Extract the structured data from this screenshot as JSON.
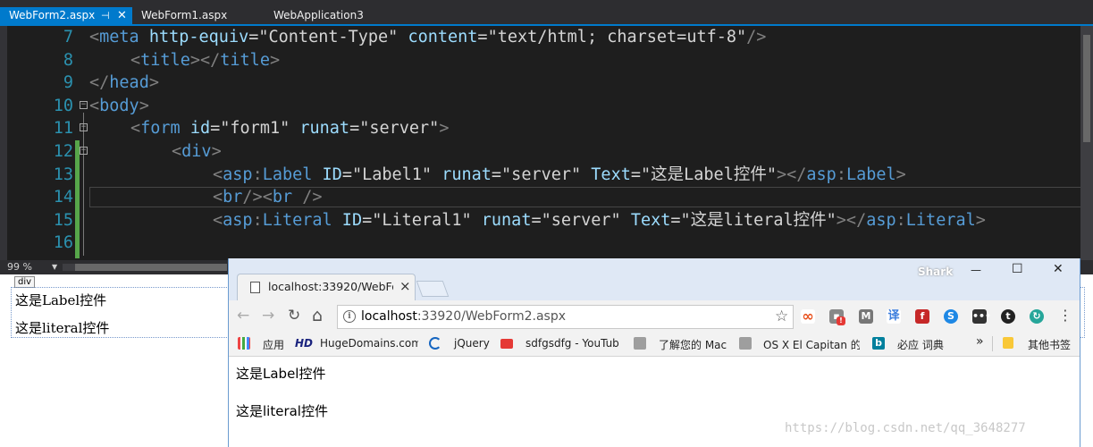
{
  "ide": {
    "tabs": [
      {
        "label": "WebForm2.aspx",
        "active": true
      },
      {
        "label": "WebForm1.aspx",
        "active": false
      },
      {
        "label": "WebApplication3",
        "active": false
      }
    ],
    "pin_icon": "pin-icon",
    "close_icon": "close-icon",
    "code_lines": [
      {
        "n": "7"
      },
      {
        "n": "8"
      },
      {
        "n": "9"
      },
      {
        "n": "10"
      },
      {
        "n": "11"
      },
      {
        "n": "12"
      },
      {
        "n": "13"
      },
      {
        "n": "14"
      },
      {
        "n": "15"
      },
      {
        "n": "16"
      }
    ],
    "code": {
      "l7_a": "<",
      "l7_tag": "meta",
      "l7_attr1": " http-equiv",
      "l7_eq1": "=",
      "l7_val1": "\"Content-Type\"",
      "l7_attr2": " content",
      "l7_eq2": "=",
      "l7_val2": "\"text/html; charset=utf-8\"",
      "l7_end": "/>",
      "l8_a": "<",
      "l8_tag": "title",
      "l8_b": "></",
      "l8_tag2": "title",
      "l8_c": ">",
      "l9_a": "</",
      "l9_tag": "head",
      "l9_b": ">",
      "l10_a": "<",
      "l10_tag": "body",
      "l10_b": ">",
      "l11_a": "<",
      "l11_tag": "form",
      "l11_attr1": " id",
      "l11_eq1": "=",
      "l11_val1": "\"form1\"",
      "l11_attr2": " runat",
      "l11_eq2": "=",
      "l11_val2": "\"server\"",
      "l11_b": ">",
      "l12_a": "<",
      "l12_tag": "div",
      "l12_b": ">",
      "l13_a": "<",
      "l13_tag": "asp",
      "l13_colon": ":",
      "l13_tag2": "Label",
      "l13_attr1": " ID",
      "l13_eq1": "=",
      "l13_val1": "\"Label1\"",
      "l13_attr2": " runat",
      "l13_eq2": "=",
      "l13_val2": "\"server\"",
      "l13_attr3": " Text",
      "l13_eq3": "=",
      "l13_val3": "\"这是Label控件\"",
      "l13_b": "></",
      "l13_tag3": "asp",
      "l13_colon2": ":",
      "l13_tag4": "Label",
      "l13_c": ">",
      "l14_a": "<",
      "l14_tag": "br",
      "l14_b": "/><",
      "l14_tag2": "br",
      "l14_c": " />",
      "l15_a": "<",
      "l15_tag": "asp",
      "l15_colon": ":",
      "l15_tag2": "Literal",
      "l15_attr1": " ID",
      "l15_eq1": "=",
      "l15_val1": "\"Literal1\"",
      "l15_attr2": " runat",
      "l15_eq2": "=",
      "l15_val2": "\"server\"",
      "l15_attr3": " Text",
      "l15_eq3": "=",
      "l15_val3": "\"这是literal控件\"",
      "l15_b": "></",
      "l15_tag3": "asp",
      "l15_colon2": ":",
      "l15_tag4": "Literal",
      "l15_c": ">"
    },
    "fold_collapse_glyph": "−",
    "zoom": "99 %",
    "zoom_arrow": "▼",
    "design": {
      "div_tag": "div",
      "label_text": "这是Label控件",
      "literal_text": "这是literal控件"
    }
  },
  "browser": {
    "tab_title": "localhost:33920/WebFo",
    "tab_close": "×",
    "profile": "Shark",
    "win_min": "—",
    "win_max": "☐",
    "win_close": "✕",
    "nav": {
      "back": "←",
      "forward": "→",
      "reload": "↻",
      "home": "⌂"
    },
    "url_host": "localhost",
    "url_rest": ":33920/WebForm2.aspx",
    "lock_glyph": "i",
    "star": "☆",
    "menu": "⋮",
    "bookmarks": [
      {
        "label": "应用",
        "icon": "apps-icon"
      },
      {
        "label": "HugeDomains.com",
        "icon": "hugedomains-icon"
      },
      {
        "label": "jQuery",
        "icon": "jquery-icon"
      },
      {
        "label": "sdfgsdfg - YouTub",
        "icon": "youtube-icon"
      },
      {
        "label": "了解您的 Mac",
        "icon": "apple-icon"
      },
      {
        "label": "OS X El Capitan 的",
        "icon": "apple-icon"
      },
      {
        "label": "必应 词典",
        "icon": "bing-icon"
      }
    ],
    "bookmarks_more": "»",
    "other_bookmarks": "其他书签",
    "hd_text": "HD",
    "page": {
      "label_text": "这是Label控件",
      "literal_text": "这是literal控件"
    }
  },
  "watermark": "https://blog.csdn.net/qq_3648277"
}
